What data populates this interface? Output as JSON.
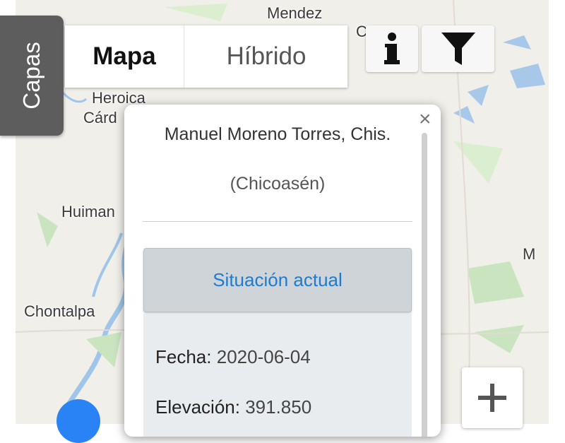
{
  "map": {
    "places": [
      "Mendez",
      "Heroica",
      "Cárd",
      "Huiman",
      "Chontalpa",
      "M",
      "C"
    ]
  },
  "layers_tab": {
    "label": "Capas"
  },
  "map_type": {
    "options": [
      "Mapa",
      "Híbrido"
    ],
    "selected": "Mapa"
  },
  "controls": {
    "info_icon": "info-icon",
    "filter_icon": "filter-icon",
    "zoom_in_icon": "plus-icon"
  },
  "popup": {
    "close_label": "×",
    "title": "Manuel Moreno Torres, Chis.",
    "subtitle": "(Chicoasén)",
    "section_label": "Situación actual",
    "fields": [
      {
        "label": "Fecha:",
        "value": "2020-06-04"
      },
      {
        "label": "Elevación:",
        "value": "391.850"
      }
    ]
  },
  "colors": {
    "accent_blue": "#1d7bd2",
    "marker": "#2a83f5",
    "river": "#9fc6ea",
    "green": "#c9e4bf"
  }
}
